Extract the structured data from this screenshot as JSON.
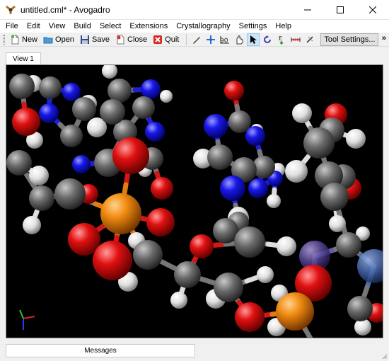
{
  "window": {
    "title": "untitled.cml* - Avogadro"
  },
  "menu": [
    "File",
    "Edit",
    "View",
    "Build",
    "Select",
    "Extensions",
    "Crystallography",
    "Settings",
    "Help"
  ],
  "toolbar": {
    "new_label": "New",
    "open_label": "Open",
    "save_label": "Save",
    "close_label": "Close",
    "quit_label": "Quit",
    "tool_settings_label": "Tool Settings...",
    "more_label": "»"
  },
  "tools": [
    "draw-tool-icon",
    "navigate-tool-icon",
    "bond-centric-tool-icon",
    "manipulate-tool-icon",
    "select-tool-icon",
    "auto-rotate-tool-icon",
    "auto-optimize-tool-icon",
    "measure-tool-icon",
    "align-tool-icon"
  ],
  "view": {
    "tab_label": "View 1"
  },
  "messages": {
    "tab_label": "Messages"
  },
  "colors": {
    "carbon": "#6a6a6a",
    "hydrogen": "#e8e8e8",
    "oxygen": "#e01010",
    "nitrogen": "#1818e8",
    "phosphorus": "#f08a10",
    "background": "#000000"
  }
}
